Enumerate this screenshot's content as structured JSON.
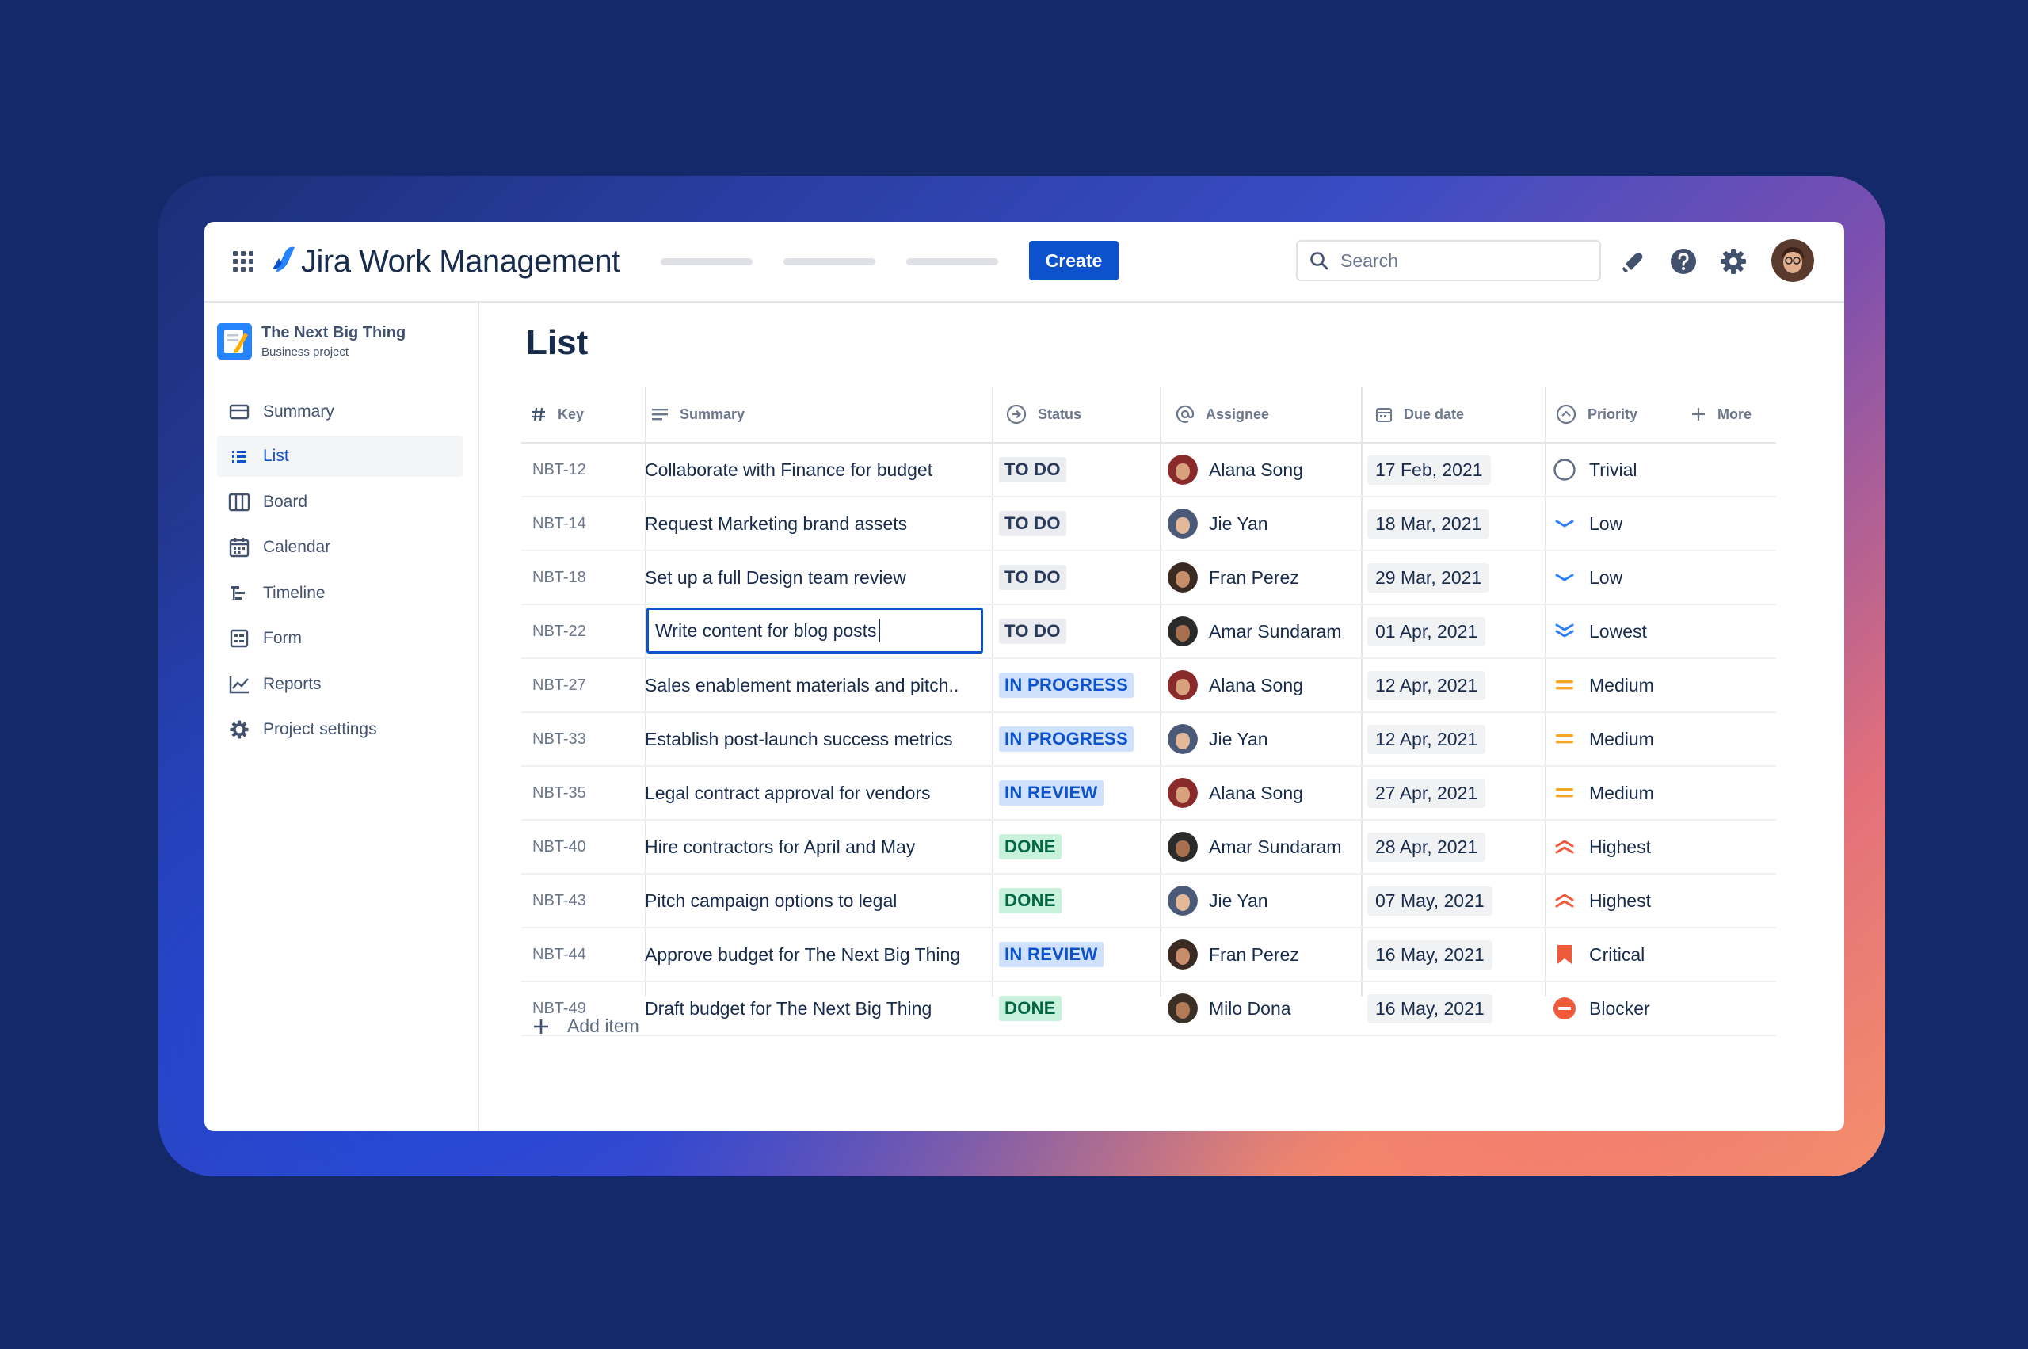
{
  "app": {
    "title": "Jira Work Management",
    "create_label": "Create"
  },
  "search": {
    "placeholder": "Search"
  },
  "project": {
    "name": "The Next Big Thing",
    "type": "Business project"
  },
  "sidebar": {
    "items": [
      {
        "label": "Summary",
        "icon": "summary-icon",
        "active": false
      },
      {
        "label": "List",
        "icon": "list-icon",
        "active": true
      },
      {
        "label": "Board",
        "icon": "board-icon",
        "active": false
      },
      {
        "label": "Calendar",
        "icon": "calendar-icon",
        "active": false
      },
      {
        "label": "Timeline",
        "icon": "timeline-icon",
        "active": false
      },
      {
        "label": "Form",
        "icon": "form-icon",
        "active": false
      },
      {
        "label": "Reports",
        "icon": "reports-icon",
        "active": false
      },
      {
        "label": "Project settings",
        "icon": "gear-icon",
        "active": false
      }
    ]
  },
  "main": {
    "title": "List",
    "columns": {
      "key": "Key",
      "summary": "Summary",
      "status": "Status",
      "assignee": "Assignee",
      "due": "Due date",
      "priority": "Priority",
      "more": "More"
    },
    "rows": [
      {
        "key": "NBT-12",
        "summary": "Collaborate with Finance for budget",
        "status": "TO DO",
        "assignee": "Alana Song",
        "due": "17 Feb, 2021",
        "priority": "Trivial"
      },
      {
        "key": "NBT-14",
        "summary": "Request Marketing brand assets",
        "status": "TO DO",
        "assignee": "Jie Yan",
        "due": "18 Mar, 2021",
        "priority": "Low"
      },
      {
        "key": "NBT-18",
        "summary": "Set up a full Design team review",
        "status": "TO DO",
        "assignee": "Fran Perez",
        "due": "29 Mar, 2021",
        "priority": "Low"
      },
      {
        "key": "NBT-22",
        "summary": "Write content for blog posts",
        "status": "TO DO",
        "assignee": "Amar Sundaram",
        "due": "01 Apr, 2021",
        "priority": "Lowest",
        "editing": true
      },
      {
        "key": "NBT-27",
        "summary": "Sales enablement materials and pitch..",
        "status": "IN PROGRESS",
        "assignee": "Alana Song",
        "due": "12 Apr, 2021",
        "priority": "Medium"
      },
      {
        "key": "NBT-33",
        "summary": "Establish post-launch success metrics",
        "status": "IN PROGRESS",
        "assignee": "Jie Yan",
        "due": "12 Apr, 2021",
        "priority": "Medium"
      },
      {
        "key": "NBT-35",
        "summary": "Legal contract approval for vendors",
        "status": "IN REVIEW",
        "assignee": "Alana Song",
        "due": "27 Apr, 2021",
        "priority": "Medium"
      },
      {
        "key": "NBT-40",
        "summary": "Hire contractors for April and May",
        "status": "DONE",
        "assignee": "Amar Sundaram",
        "due": "28 Apr, 2021",
        "priority": "Highest"
      },
      {
        "key": "NBT-43",
        "summary": "Pitch campaign options to legal",
        "status": "DONE",
        "assignee": "Jie Yan",
        "due": "07 May, 2021",
        "priority": "Highest"
      },
      {
        "key": "NBT-44",
        "summary": "Approve budget for The Next Big Thing",
        "status": "IN REVIEW",
        "assignee": "Fran Perez",
        "due": "16 May, 2021",
        "priority": "Critical"
      },
      {
        "key": "NBT-49",
        "summary": "Draft budget for The Next Big Thing",
        "status": "DONE",
        "assignee": "Milo Dona",
        "due": "16 May, 2021",
        "priority": "Blocker"
      }
    ],
    "add_item_label": "Add item"
  },
  "colors": {
    "brand": "#0c52cc",
    "todo_bg": "#eaecf0",
    "progress_bg": "#cfe1fd",
    "done_bg": "#c8f2dc",
    "done_text": "#006644",
    "medium": "#f5a524",
    "high": "#f05a3c",
    "low": "#2d7ff9"
  }
}
